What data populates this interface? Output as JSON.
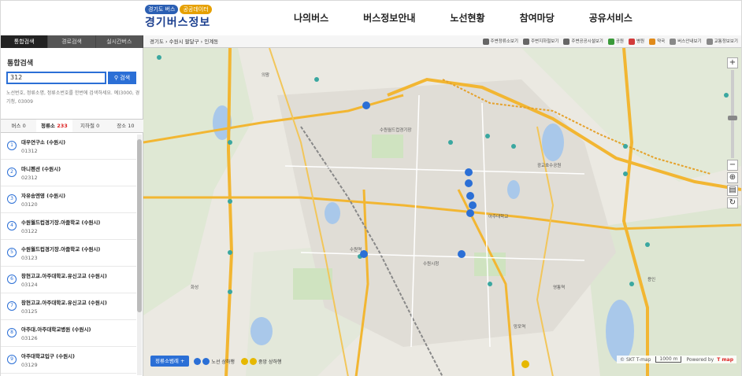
{
  "header": {
    "logo_tags": [
      "경기도 버스",
      "공공데이터"
    ],
    "logo_title": "경기버스정보",
    "nav": [
      "나의버스",
      "버스정보안내",
      "노선현황",
      "참여마당",
      "공유서비스"
    ]
  },
  "left_tabs": [
    "통합검색",
    "경로검색",
    "실시간버스"
  ],
  "search": {
    "title": "통합검색",
    "value": "312",
    "button": "검색",
    "help": "노선번호, 정류소명, 정류소번호를 한번에 검색하세요. 예)3000, 경기청, 03009"
  },
  "result_tabs": [
    {
      "label": "버스",
      "count": "0"
    },
    {
      "label": "정류소",
      "count": "233"
    },
    {
      "label": "지하철",
      "count": "0"
    },
    {
      "label": "장소",
      "count": "10"
    }
  ],
  "results": [
    {
      "num": "1",
      "name": "대우연구소 (수원시)",
      "code": "01312"
    },
    {
      "num": "2",
      "name": "마니펜션 (수원시)",
      "code": "02312"
    },
    {
      "num": "3",
      "name": "자유송엔영 (수원시)",
      "code": "03120"
    },
    {
      "num": "4",
      "name": "수원월드컵경기장.아줌학교 (수원시)",
      "code": "03122"
    },
    {
      "num": "5",
      "name": "수원월드컵경기장.아줌학교 (수원시)",
      "code": "03123"
    },
    {
      "num": "6",
      "name": "창현고교.아주대학교.유신고교 (수원시)",
      "code": "03124"
    },
    {
      "num": "7",
      "name": "창현고교.아주대학교.유신고교 (수원시)",
      "code": "03125"
    },
    {
      "num": "8",
      "name": "아주대.아주대학교병원 (수원시)",
      "code": "03126"
    },
    {
      "num": "9",
      "name": "아주대학교입구 (수원시)",
      "code": "03129"
    }
  ],
  "map_bar": {
    "breadcrumb": "경기도 › 수원시 팔달구 › 인계동",
    "layers": [
      {
        "label": "주변정류소보기",
        "color": "#666666"
      },
      {
        "label": "주변지하철보기",
        "color": "#666666"
      },
      {
        "label": "주변공공시설보기",
        "color": "#666666"
      },
      {
        "label": "공원",
        "color": "#3a9a3a"
      },
      {
        "label": "병원",
        "color": "#d23a3a"
      },
      {
        "label": "약국",
        "color": "#e08a1a"
      },
      {
        "label": "버스안내보기",
        "color": "#888888"
      },
      {
        "label": "교통정보보기",
        "color": "#888888"
      }
    ]
  },
  "map_labels": [
    "수원역",
    "수원시청",
    "아주대학교",
    "광교호수공원",
    "수원월드컵경기장",
    "영통역",
    "망포역",
    "용인",
    "화성",
    "의왕"
  ],
  "legend": {
    "button": "정류소범례 +",
    "items": [
      {
        "label": "노선 상하행",
        "color": "#2b6fd6"
      },
      {
        "label": "중앙 상하행",
        "color": "#e6b800"
      }
    ]
  },
  "copyright": {
    "text": "© SKT T-map",
    "scale": "1000 m",
    "powered": "Powered by",
    "brand": "T map"
  },
  "zoom": {
    "plus": "+",
    "minus": "−"
  }
}
